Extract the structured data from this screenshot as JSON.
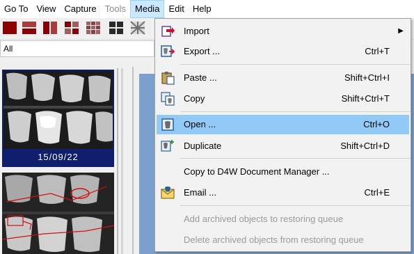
{
  "menubar": {
    "items": [
      "Go To",
      "View",
      "Capture",
      "Tools",
      "Media",
      "Edit",
      "Help"
    ],
    "disabled": "Tools",
    "active": "Media"
  },
  "filter": {
    "value": "All"
  },
  "thumbnail": {
    "date": "15/09/22"
  },
  "media_menu": {
    "items": [
      {
        "label": "Import",
        "shortcut": "",
        "submenu": true,
        "icon": "import-icon"
      },
      {
        "label": "Export ...",
        "shortcut": "Ctrl+T",
        "icon": "export-icon"
      },
      {
        "label": "Paste ...",
        "shortcut": "Shift+Ctrl+I",
        "icon": "paste-icon"
      },
      {
        "label": "Copy",
        "shortcut": "Shift+Ctrl+T",
        "icon": "copy-icon"
      },
      {
        "label": "Open ...",
        "shortcut": "Ctrl+O",
        "icon": "open-icon",
        "highlighted": true
      },
      {
        "label": "Duplicate",
        "shortcut": "Shift+Ctrl+D",
        "icon": "duplicate-icon"
      },
      {
        "label": "Copy to D4W Document Manager ...",
        "shortcut": ""
      },
      {
        "label": "Email ...",
        "shortcut": "Ctrl+E",
        "icon": "email-icon"
      },
      {
        "label": "Add archived objects to restoring queue",
        "disabled": true
      },
      {
        "label": "Delete archived objects from restoring queue",
        "disabled": true
      }
    ]
  },
  "colors": {
    "highlight": "#91c9f7",
    "thumb_frame": "#0f1f6e",
    "toolbar_red": "#8b0000",
    "panel_blue": "#7d9fcc"
  }
}
